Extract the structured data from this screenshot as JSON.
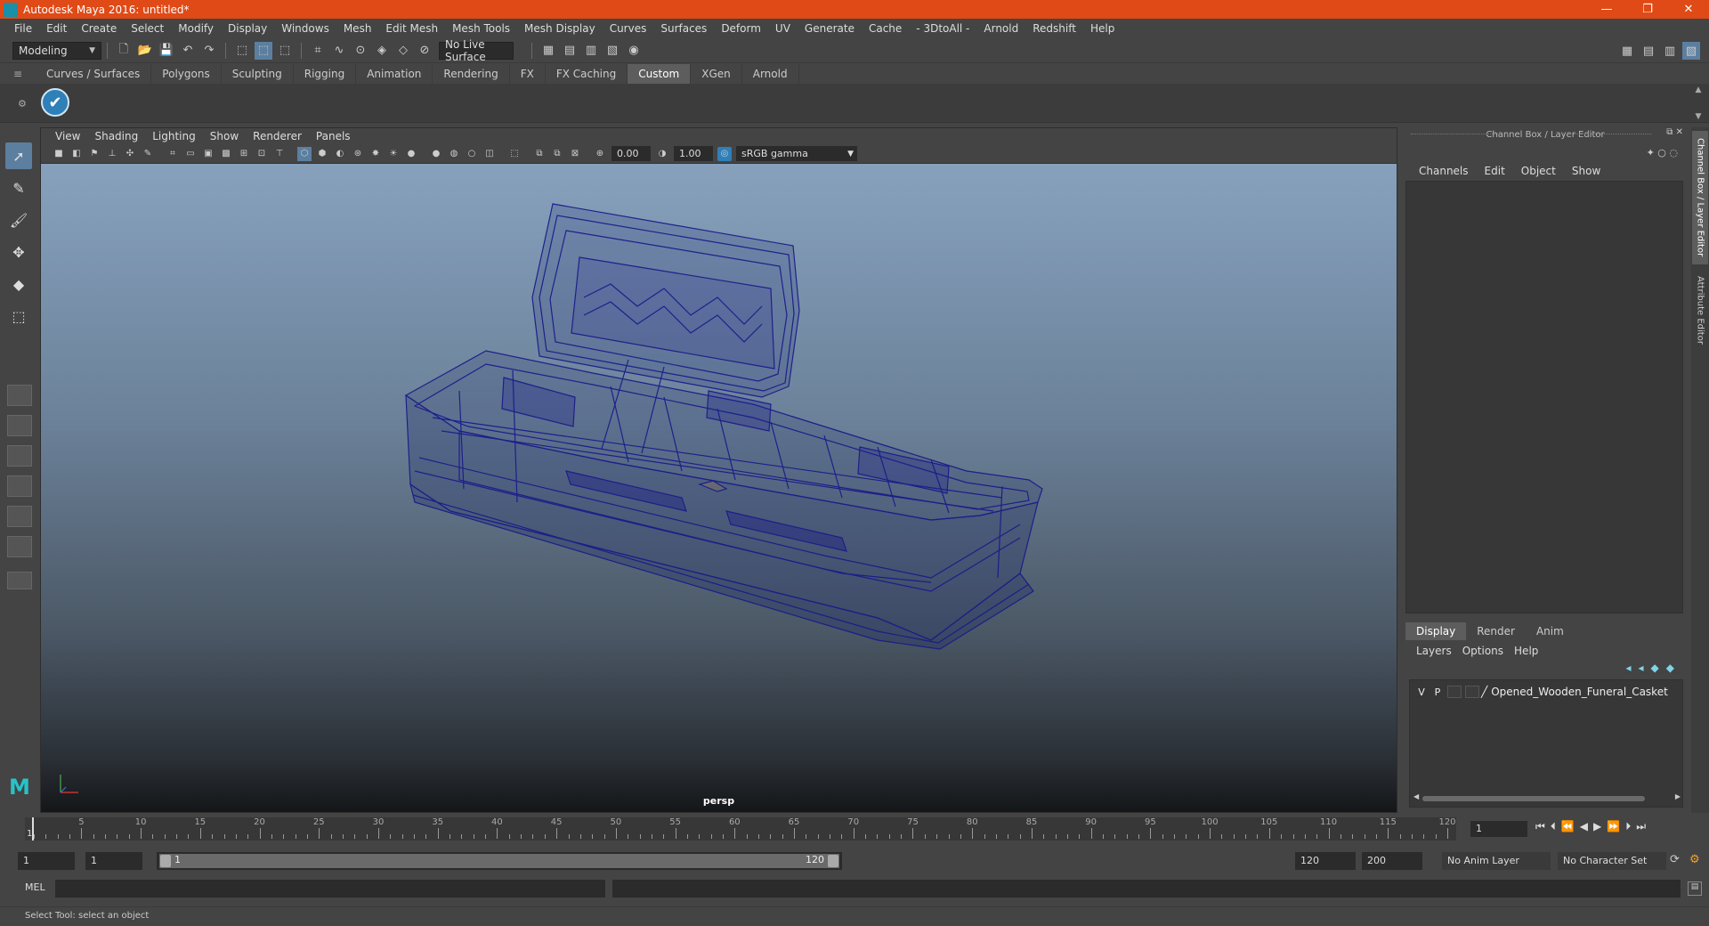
{
  "window": {
    "title": "Autodesk Maya 2016: untitled*",
    "controls": [
      "—",
      "❐",
      "✕"
    ]
  },
  "menubar": [
    "File",
    "Edit",
    "Create",
    "Select",
    "Modify",
    "Display",
    "Windows",
    "Mesh",
    "Edit Mesh",
    "Mesh Tools",
    "Mesh Display",
    "Curves",
    "Surfaces",
    "Deform",
    "UV",
    "Generate",
    "Cache",
    "- 3DtoAll -",
    "Arnold",
    "Redshift",
    "Help"
  ],
  "statusline": {
    "mode": "Modeling",
    "live_surface": "No Live Surface"
  },
  "shelf_tabs": [
    "Curves / Surfaces",
    "Polygons",
    "Sculpting",
    "Rigging",
    "Animation",
    "Rendering",
    "FX",
    "FX Caching",
    "Custom",
    "XGen",
    "Arnold"
  ],
  "active_shelf_tab": "Custom",
  "panel_menu": [
    "View",
    "Shading",
    "Lighting",
    "Show",
    "Renderer",
    "Panels"
  ],
  "panel_tools": {
    "exposure": "0.00",
    "gamma": "1.00",
    "color_space": "sRGB gamma"
  },
  "viewport": {
    "camera": "persp"
  },
  "channel_box": {
    "title": "Channel Box / Layer Editor",
    "menu": [
      "Channels",
      "Edit",
      "Object",
      "Show"
    ],
    "layer_tabs": [
      "Display",
      "Render",
      "Anim"
    ],
    "active_layer_tab": "Display",
    "layer_menu": [
      "Layers",
      "Options",
      "Help"
    ],
    "layers": [
      {
        "v": "V",
        "p": "P",
        "name": "Opened_Wooden_Funeral_Casket"
      }
    ]
  },
  "side_tabs": [
    "Channel Box / Layer Editor",
    "Attribute Editor"
  ],
  "time_slider": {
    "ticks": [
      "5",
      "10",
      "15",
      "20",
      "25",
      "30",
      "35",
      "40",
      "45",
      "50",
      "55",
      "60",
      "65",
      "70",
      "75",
      "80",
      "85",
      "90",
      "95",
      "100",
      "105",
      "110",
      "115",
      "120"
    ],
    "start_label": "1",
    "current_frame": "1"
  },
  "range_slider": {
    "start": "1",
    "playback_start": "1",
    "range_start_label": "1",
    "range_end_label": "120",
    "playback_end": "120",
    "end": "200",
    "anim_layer": "No Anim Layer",
    "character_set": "No Character Set"
  },
  "command_line": {
    "label": "MEL"
  },
  "help_line": "Select Tool: select an object",
  "colors": {
    "title_bar": "#e04a16",
    "wireframe": "#1a1a8a",
    "accent": "#5c7fa0"
  }
}
